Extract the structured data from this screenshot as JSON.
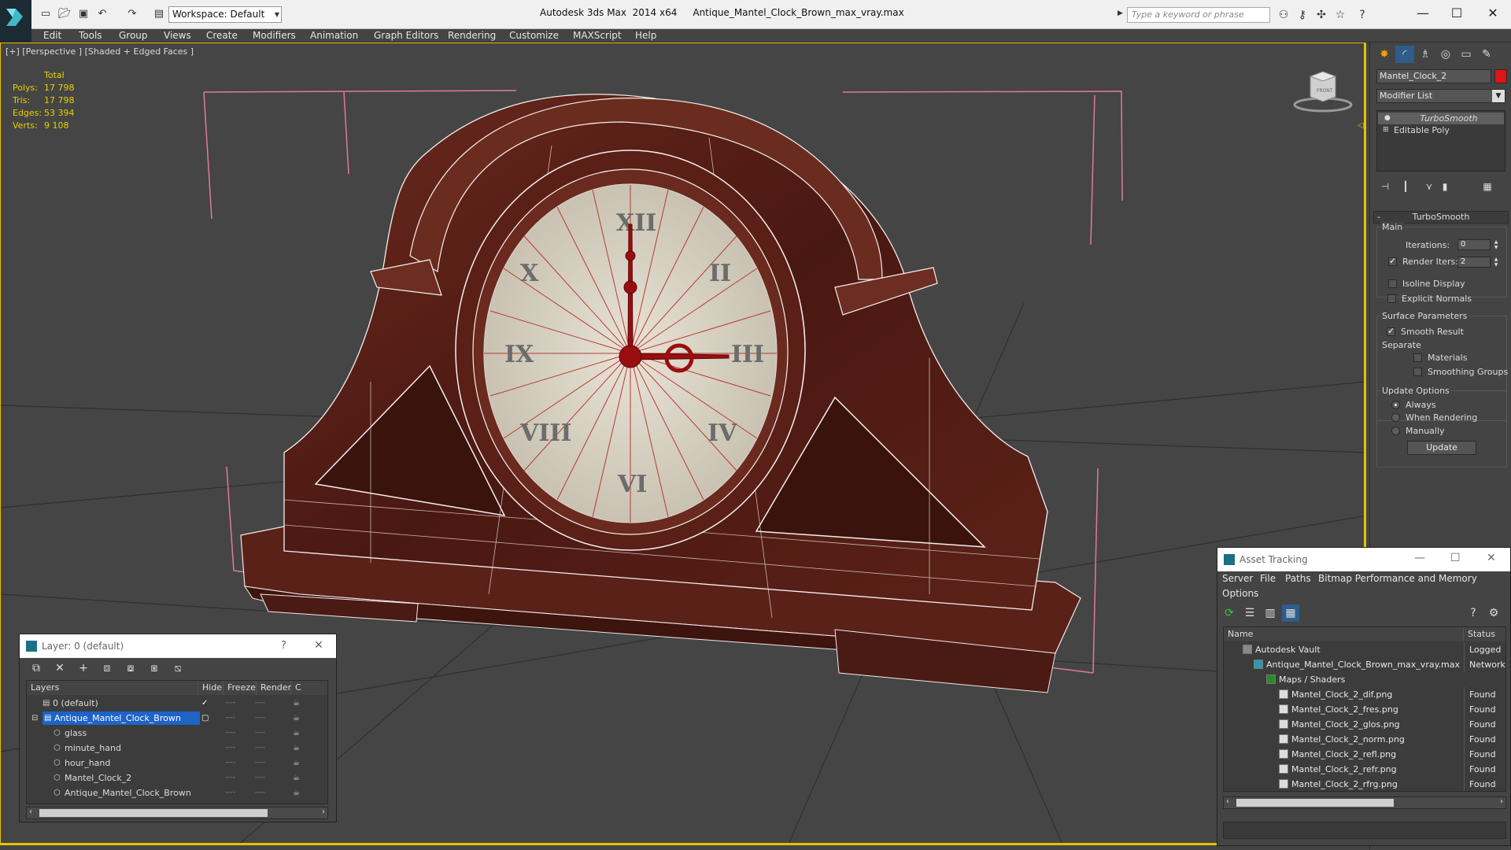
{
  "titlebar": {
    "workspace": "Workspace: Default",
    "app_title": "Autodesk 3ds Max  2014 x64",
    "file_title": "Antique_Mantel_Clock_Brown_max_vray.max",
    "search_placeholder": "Type a keyword or phrase"
  },
  "menu": [
    "Edit",
    "Tools",
    "Group",
    "Views",
    "Create",
    "Modifiers",
    "Animation",
    "Graph Editors",
    "Rendering",
    "Customize",
    "MAXScript",
    "Help"
  ],
  "viewport": {
    "label": "[+] [Perspective ] [Shaded + Edged Faces ]",
    "stats": {
      "header": "Total",
      "rows": [
        {
          "k": "Polys:",
          "v": "17 798"
        },
        {
          "k": "Tris:",
          "v": "17 798"
        },
        {
          "k": "Edges:",
          "v": "53 394"
        },
        {
          "k": "Verts:",
          "v": "9 108"
        }
      ]
    },
    "viewcube_label": "FRONT"
  },
  "command_panel": {
    "object_name": "Mantel_Clock_2",
    "object_color": "#e01414",
    "modifier_list": "Modifier List",
    "stack": [
      "TurboSmooth",
      "Editable Poly"
    ],
    "rollout_title": "TurboSmooth",
    "main_group": "Main",
    "iterations_label": "Iterations:",
    "iterations_value": "0",
    "render_iters_label": "Render Iters:",
    "render_iters_value": "2",
    "render_iters_checked": true,
    "isoline_label": "Isoline Display",
    "explicit_normals_label": "Explicit Normals",
    "surface_group": "Surface Parameters",
    "smooth_result_label": "Smooth Result",
    "separate_label": "Separate",
    "materials_label": "Materials",
    "smoothing_groups_label": "Smoothing Groups",
    "update_group": "Update Options",
    "update_always": "Always",
    "update_rendering": "When Rendering",
    "update_manually": "Manually",
    "update_button": "Update"
  },
  "layer_window": {
    "title": "Layer: 0 (default)",
    "help": "?",
    "columns": [
      "Layers",
      "Hide",
      "Freeze",
      "Render",
      "C"
    ],
    "rows": [
      {
        "name": "0 (default)",
        "indent": 1,
        "checked": true,
        "selected": false
      },
      {
        "name": "Antique_Mantel_Clock_Brown",
        "indent": 1,
        "checked": false,
        "selected": true
      },
      {
        "name": "glass",
        "indent": 2,
        "checked": false,
        "selected": false
      },
      {
        "name": "minute_hand",
        "indent": 2,
        "checked": false,
        "selected": false
      },
      {
        "name": "hour_hand",
        "indent": 2,
        "checked": false,
        "selected": false
      },
      {
        "name": "Mantel_Clock_2",
        "indent": 2,
        "checked": false,
        "selected": false
      },
      {
        "name": "Antique_Mantel_Clock_Brown",
        "indent": 2,
        "checked": false,
        "selected": false
      }
    ]
  },
  "asset_window": {
    "title": "Asset Tracking",
    "menu": [
      "Server",
      "File",
      "Paths",
      "Bitmap Performance and Memory",
      "Options"
    ],
    "columns": [
      "Name",
      "Status"
    ],
    "rows": [
      {
        "name": "Autodesk Vault",
        "status": "Logged",
        "indent": 1
      },
      {
        "name": "Antique_Mantel_Clock_Brown_max_vray.max",
        "status": "Network",
        "indent": 2
      },
      {
        "name": "Maps / Shaders",
        "status": "",
        "indent": 3
      },
      {
        "name": "Mantel_Clock_2_dif.png",
        "status": "Found",
        "indent": 4
      },
      {
        "name": "Mantel_Clock_2_fres.png",
        "status": "Found",
        "indent": 4
      },
      {
        "name": "Mantel_Clock_2_glos.png",
        "status": "Found",
        "indent": 4
      },
      {
        "name": "Mantel_Clock_2_norm.png",
        "status": "Found",
        "indent": 4
      },
      {
        "name": "Mantel_Clock_2_refl.png",
        "status": "Found",
        "indent": 4
      },
      {
        "name": "Mantel_Clock_2_refr.png",
        "status": "Found",
        "indent": 4
      },
      {
        "name": "Mantel_Clock_2_rfrg.png",
        "status": "Found",
        "indent": 4
      }
    ]
  }
}
